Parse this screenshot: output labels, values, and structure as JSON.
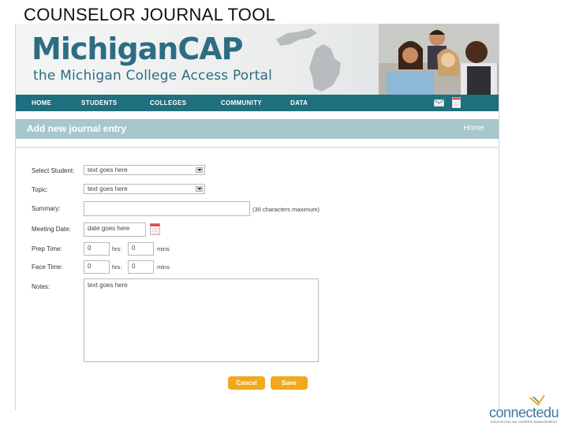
{
  "slide_title": "COUNSELOR JOURNAL TOOL",
  "banner": {
    "logo_part1": "Michigan",
    "logo_part2": "CAP",
    "subtitle": "the Michigan College Access Portal"
  },
  "nav": {
    "items": [
      "HOME",
      "STUDENTS",
      "COLLEGES",
      "COMMUNITY",
      "DATA"
    ]
  },
  "page": {
    "title": "Add new journal entry",
    "home_link": "Home"
  },
  "form": {
    "select_student_label": "Select Student:",
    "select_student_value": "text goes here",
    "topic_label": "Topic:",
    "topic_value": "text goes here",
    "summary_label": "Summary:",
    "summary_value": "",
    "summary_hint": "(30 characters maximum)",
    "meeting_date_label": "Meeting Date:",
    "meeting_date_value": "date goes here",
    "prep_time_label": "Prep Time:",
    "prep_hours": "0",
    "prep_hrs_label": "hrs:",
    "prep_mins": "0",
    "prep_mins_label": "mins",
    "face_time_label": "Face Time:",
    "face_hours": "0",
    "face_hrs_label": "hrs:",
    "face_mins": "0",
    "face_mins_label": "mins",
    "notes_label": "Notes:",
    "notes_value": "text goes here",
    "cancel_label": "Cancel",
    "save_label": "Save"
  },
  "footer_logo": {
    "name": "connectedu",
    "tagline": "EDUCATION and CAREER MANAGEMENT"
  },
  "colors": {
    "nav": "#1f6f7e",
    "header_bar": "#a7c7cd",
    "brand": "#2c6d82",
    "button": "#f2a81d"
  }
}
